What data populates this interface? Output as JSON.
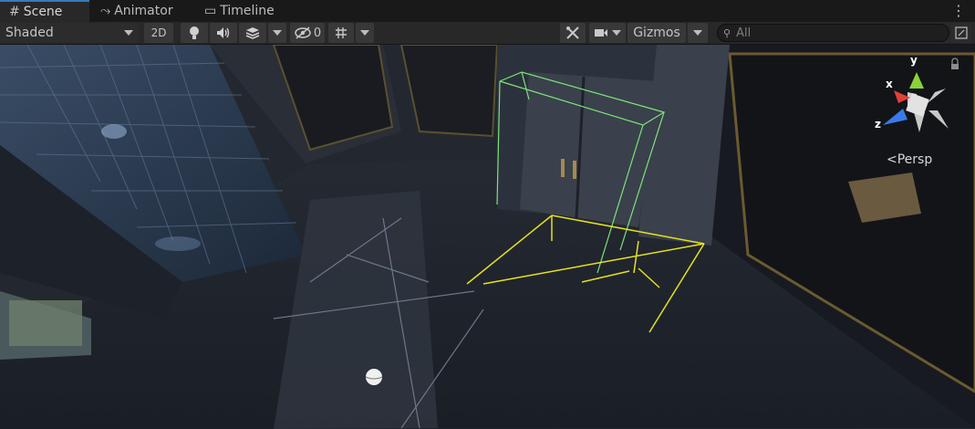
{
  "tabs": [
    {
      "label": "Scene",
      "icon": "grid-icon"
    },
    {
      "label": "Animator",
      "icon": "animator-icon"
    },
    {
      "label": "Timeline",
      "icon": "timeline-icon"
    }
  ],
  "toolbar": {
    "draw_mode": "Shaded",
    "mode_2d": "2D",
    "hidden_count": "0",
    "gizmos_label": "Gizmos",
    "search_placeholder": "All"
  },
  "scene_gizmo": {
    "x_label": "x",
    "y_label": "y",
    "z_label": "z",
    "projection": "Persp"
  },
  "colors": {
    "tab_accent": "#3a79bb",
    "gizmo_x": "#e0403a",
    "gizmo_y": "#8ad13a",
    "gizmo_z": "#3a7ae8",
    "bounds_green": "#7ee37a",
    "wire_yellow": "#e6e21c"
  }
}
